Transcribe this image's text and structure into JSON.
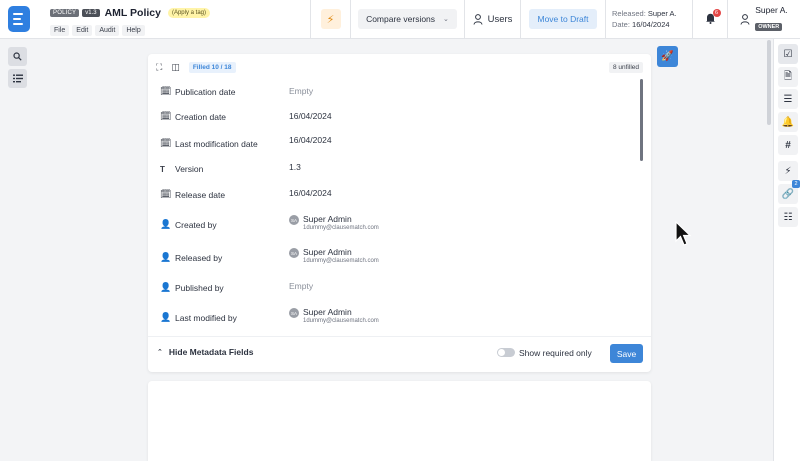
{
  "header": {
    "doc_type_badge": "POLICY",
    "version_badge": "v1.3",
    "title": "AML Policy",
    "tag_button": "(Apply a tag)",
    "menu": [
      "File",
      "Edit",
      "Audit",
      "Help"
    ],
    "compare_label": "Compare versions",
    "users_label": "Users",
    "move_label": "Move to Draft",
    "released_label": "Released:",
    "released_value": "Super A.",
    "date_label": "Date:",
    "date_value": "16/04/2024",
    "notifications_count": "6",
    "user_name": "Super A.",
    "user_role": "OWNER"
  },
  "panel": {
    "filled": "Filled 10 / 18",
    "unfilled": "8 unfilled",
    "fields": [
      {
        "label": "Publication date",
        "value": "Empty"
      },
      {
        "label": "Creation date",
        "value": "16/04/2024"
      },
      {
        "label": "Last modification date",
        "value": "16/04/2024"
      },
      {
        "label": "Version",
        "value": "1.3"
      },
      {
        "label": "Release date",
        "value": "16/04/2024"
      },
      {
        "label": "Created by",
        "name": "Super Admin",
        "email": "1dummy@clausematch.com",
        "initials": "SA"
      },
      {
        "label": "Released by",
        "name": "Super Admin",
        "email": "1dummy@clausematch.com",
        "initials": "SA"
      },
      {
        "label": "Published by",
        "value": "Empty"
      },
      {
        "label": "Last modified by",
        "name": "Super Admin",
        "email": "1dummy@clausematch.com",
        "initials": "SA"
      }
    ],
    "hide_label": "Hide Metadata Fields",
    "required_label": "Show required only",
    "save_label": "Save"
  },
  "right_rail": {
    "link_badge": "2"
  },
  "colors": {
    "accent": "#3d86d8",
    "notification": "#e34646"
  }
}
